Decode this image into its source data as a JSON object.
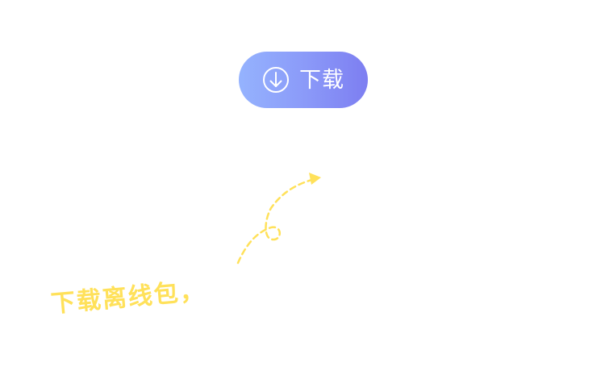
{
  "download_button": {
    "label": "下载",
    "icon": "download-circle-icon"
  },
  "hint": {
    "text": "下载离线包，",
    "color": "#ffe15a"
  },
  "colors": {
    "button_gradient_start": "#95b3fe",
    "button_gradient_end": "#7d7ef1",
    "arrow": "#ffe15a"
  }
}
